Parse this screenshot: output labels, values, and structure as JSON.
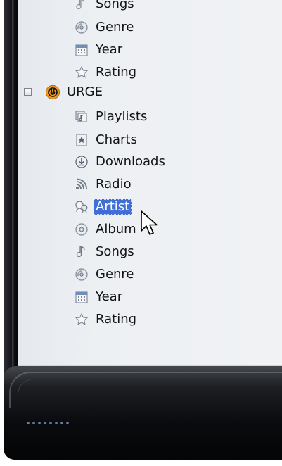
{
  "tree": {
    "library_items_top": [
      {
        "label": "Songs",
        "icon": "music-note-icon"
      },
      {
        "label": "Genre",
        "icon": "genre-disc-icon"
      },
      {
        "label": "Year",
        "icon": "calendar-icon"
      },
      {
        "label": "Rating",
        "icon": "star-icon"
      }
    ],
    "urge": {
      "label": "URGE",
      "icon": "urge-power-icon",
      "expander": "collapse-minus-icon",
      "items": [
        {
          "label": "Playlists",
          "icon": "playlists-icon"
        },
        {
          "label": "Charts",
          "icon": "charts-icon"
        },
        {
          "label": "Downloads",
          "icon": "download-icon"
        },
        {
          "label": "Radio",
          "icon": "radio-icon"
        },
        {
          "label": "Artist",
          "icon": "artist-icon",
          "selected": true
        },
        {
          "label": "Album",
          "icon": "album-disc-icon"
        },
        {
          "label": "Songs",
          "icon": "music-note-icon"
        },
        {
          "label": "Genre",
          "icon": "genre-disc-icon"
        },
        {
          "label": "Year",
          "icon": "calendar-icon"
        },
        {
          "label": "Rating",
          "icon": "star-icon"
        }
      ]
    }
  },
  "colors": {
    "selection": "#3f6ed6",
    "urge_orange": "#f39a1c",
    "frame_dark": "#0c0d10",
    "panel_bg": "#edf0f3"
  },
  "cursor": "mouse-pointer-icon"
}
